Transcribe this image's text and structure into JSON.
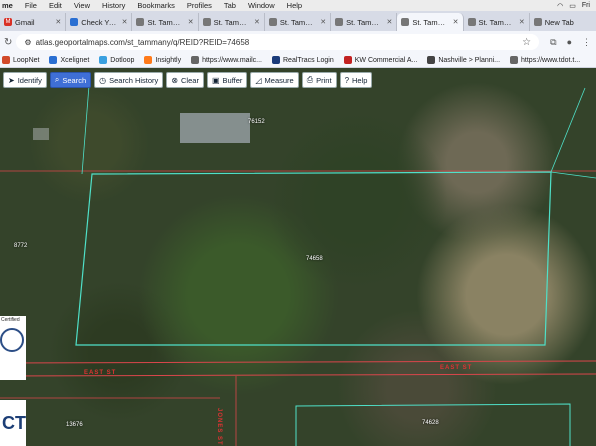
{
  "menubar": {
    "items": [
      "me",
      "File",
      "Edit",
      "View",
      "History",
      "Bookmarks",
      "Profiles",
      "Tab",
      "Window",
      "Help"
    ],
    "right": [
      "Fri"
    ]
  },
  "tabs": [
    {
      "label": "Gmail",
      "icon": "gmail-icon",
      "active": false
    },
    {
      "label": "Check Your",
      "icon": "page-icon",
      "active": false
    },
    {
      "label": "St. Tammany",
      "icon": "page-icon",
      "active": false
    },
    {
      "label": "St. Tammany",
      "icon": "page-icon",
      "active": false
    },
    {
      "label": "St. Tammany",
      "icon": "page-icon",
      "active": false
    },
    {
      "label": "St. Tammany",
      "icon": "page-icon",
      "active": false
    },
    {
      "label": "St. Tammany",
      "icon": "page-icon",
      "active": true
    },
    {
      "label": "St. Tammany",
      "icon": "page-icon",
      "active": false
    },
    {
      "label": "New Tab",
      "icon": "page-icon",
      "active": false
    }
  ],
  "address": {
    "url": "atlas.geoportalmaps.com/st_tammany/q/REID?REID=74658"
  },
  "bookmarks": [
    {
      "label": "LoopNet",
      "color": "#d24a2a"
    },
    {
      "label": "Xcelignet",
      "color": "#2a6fd2"
    },
    {
      "label": "Dotloop",
      "color": "#3aa0e0"
    },
    {
      "label": "Insightly",
      "color": "#ff7a1a"
    },
    {
      "label": "https://www.mailc...",
      "color": "#666666"
    },
    {
      "label": "RealTracs Login",
      "color": "#1a3b7a"
    },
    {
      "label": "KW Commercial A...",
      "color": "#c22222"
    },
    {
      "label": "Nashville > Planni...",
      "color": "#444444"
    },
    {
      "label": "https://www.tdot.t...",
      "color": "#666666"
    }
  ],
  "toolbar": {
    "identify": "Identify",
    "search": "Search",
    "search_history": "Search History",
    "clear": "Clear",
    "buffer": "Buffer",
    "measure": "Measure",
    "print": "Print",
    "help": "Help"
  },
  "map": {
    "parcel_labels": [
      "76152",
      "74658",
      "8772",
      "13676",
      "74628"
    ],
    "streets": [
      "EAST ST",
      "EAST ST",
      "JONES ST"
    ],
    "logo_text": "Certified",
    "logo_letters": "CT"
  }
}
